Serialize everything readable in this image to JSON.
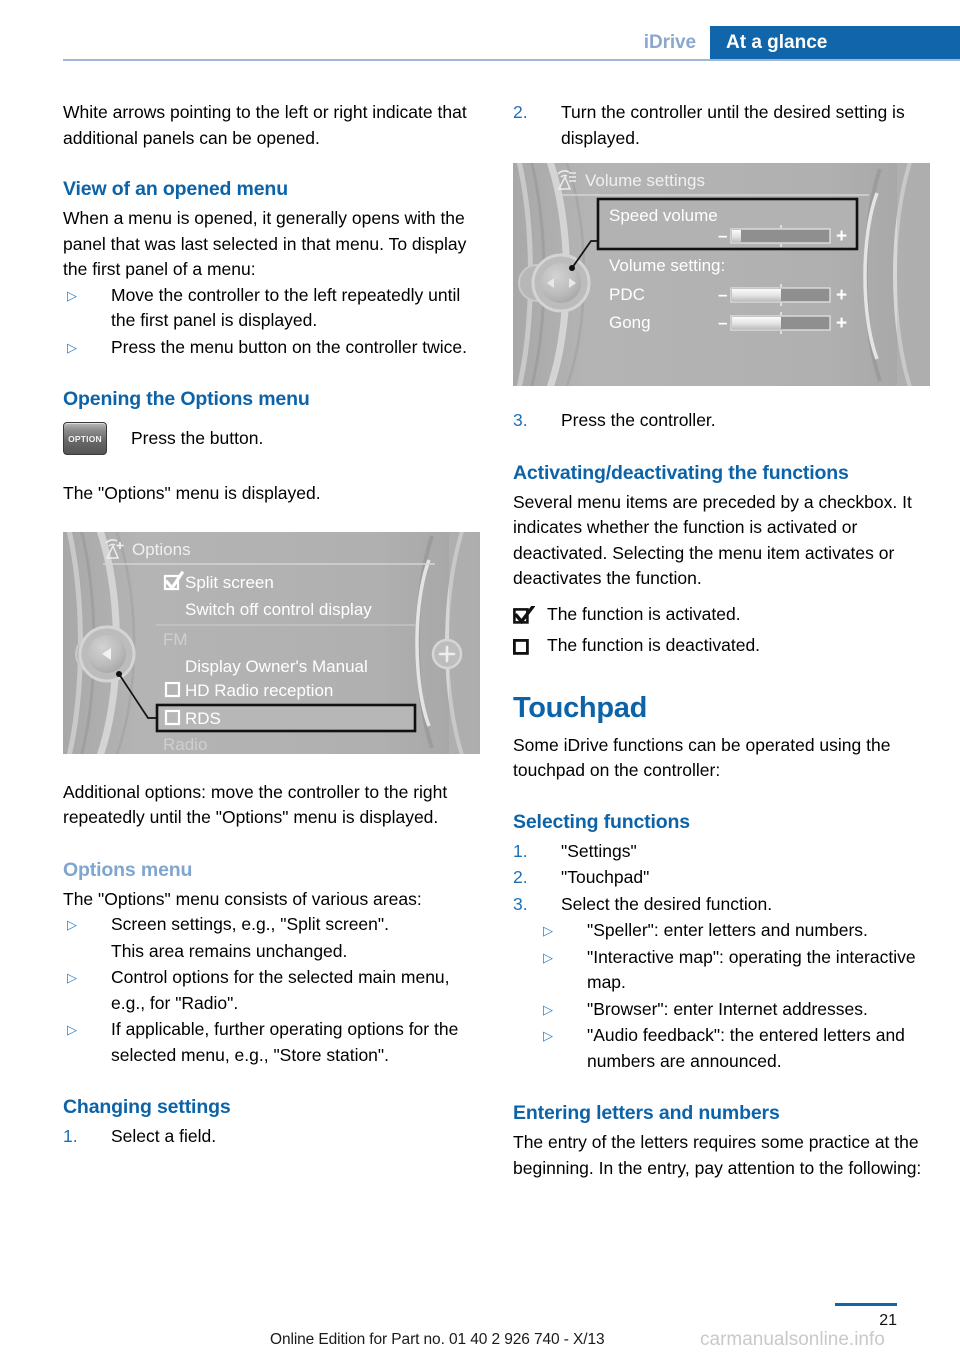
{
  "header": {
    "chapter": "iDrive",
    "section": "At a glance"
  },
  "left_column": {
    "intro_para": "White arrows pointing to the left or right indicate that additional panels can be opened.",
    "view_menu": {
      "heading": "View of an opened menu",
      "para": "When a menu is opened, it generally opens with the panel that was last selected in that menu. To display the first panel of a menu:",
      "bullets": [
        "Move the controller to the left repeatedly until the first panel is displayed.",
        "Press the menu button on the controller twice."
      ]
    },
    "opening_options": {
      "heading": "Opening the Options menu",
      "button_label": "OPTION",
      "button_text": "Press the button.",
      "result_para": "The \"Options\" menu is displayed."
    },
    "options_screen": {
      "title": "Options",
      "items": [
        {
          "label": "Split screen",
          "checkbox": "checked"
        },
        {
          "label": "Switch off control display",
          "checkbox": "none"
        },
        {
          "label": "FM",
          "checkbox": "none",
          "dim": true
        },
        {
          "label": "Display Owner's Manual",
          "checkbox": "none"
        },
        {
          "label": "HD Radio reception",
          "checkbox": "unchecked"
        },
        {
          "label": "RDS",
          "checkbox": "unchecked",
          "highlighted": true
        },
        {
          "label": "Radio",
          "checkbox": "none",
          "dim": true
        }
      ],
      "left_arrow": "◀",
      "right_button": "+"
    },
    "additional_para": "Additional options: move the controller to the right repeatedly until the \"Options\" menu is displayed.",
    "options_menu": {
      "heading": "Options menu",
      "para": "The \"Options\" menu consists of various areas:",
      "bullets": [
        "Screen settings, e.g., \"Split screen\".",
        "Control options for the selected main menu, e.g., for \"Radio\".",
        "If applicable, further operating options for the selected menu, e.g., \"Store station\"."
      ],
      "sub_para": "This area remains unchanged."
    },
    "changing_settings": {
      "heading": "Changing settings",
      "steps": [
        {
          "num": "1.",
          "text": "Select a field."
        }
      ]
    }
  },
  "right_column": {
    "steps_continued": [
      {
        "num": "2.",
        "text": "Turn the controller until the desired setting is displayed."
      }
    ],
    "volume_screen": {
      "title": "Volume settings",
      "highlighted_row": "Speed volume",
      "group_label": "Volume setting:",
      "sliders": [
        {
          "label": "Speed volume",
          "minus": "–",
          "plus": "+",
          "fill_pct": 8,
          "highlighted": true
        },
        {
          "label": "PDC",
          "minus": "–",
          "plus": "+",
          "fill_pct": 50,
          "highlighted": false
        },
        {
          "label": "Gong",
          "minus": "–",
          "plus": "+",
          "fill_pct": 50,
          "highlighted": false
        }
      ]
    },
    "step3": {
      "num": "3.",
      "text": "Press the controller."
    },
    "activating": {
      "heading": "Activating/deactivating the functions",
      "para": "Several menu items are preceded by a checkbox. It indicates whether the function is activated or deactivated. Selecting the menu item activates or deactivates the function.",
      "legend": [
        {
          "state": "checked",
          "text": "The function is activated."
        },
        {
          "state": "unchecked",
          "text": "The function is deactivated."
        }
      ]
    },
    "touchpad": {
      "heading": "Touchpad",
      "para": "Some iDrive functions can be operated using the touchpad on the controller:"
    },
    "selecting_functions": {
      "heading": "Selecting functions",
      "steps": [
        {
          "num": "1.",
          "text": "\"Settings\""
        },
        {
          "num": "2.",
          "text": "\"Touchpad\""
        },
        {
          "num": "3.",
          "text": "Select the desired function."
        }
      ],
      "bullets": [
        "\"Speller\": enter letters and numbers.",
        "\"Interactive map\": operating the interactive map.",
        "\"Browser\": enter Internet addresses.",
        "\"Audio feedback\": the entered letters and numbers are announced."
      ]
    },
    "entering": {
      "heading": "Entering letters and numbers",
      "para": "The entry of the letters requires some practice at the beginning. In the entry, pay attention to the following:"
    }
  },
  "footer": {
    "edition_note": "Online Edition for Part no. 01 40 2 926 740 - X/13",
    "watermark": "carmanualsonline.info",
    "page_number": "21"
  },
  "colors": {
    "accent_blue": "#1165aa",
    "heading_blue": "#0d63a8",
    "muted_blue": "#7fa6cf",
    "screen_gray": "#b2b2b2"
  }
}
